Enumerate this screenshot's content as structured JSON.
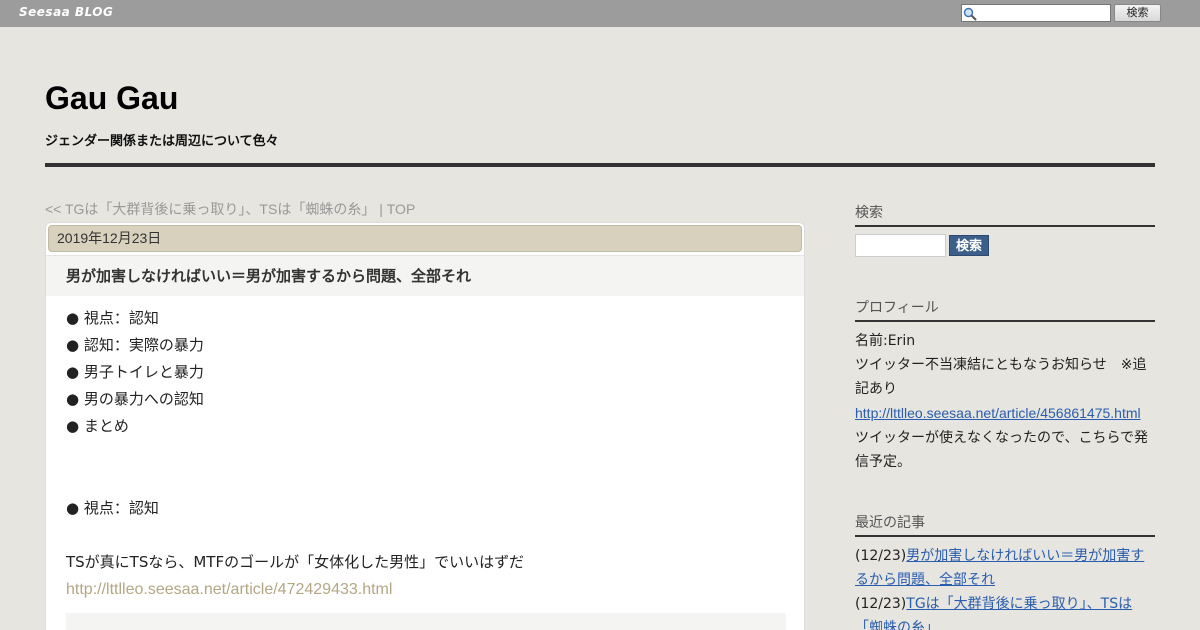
{
  "topbar": {
    "logo": "Seesaa BLOG",
    "search_placeholder": "",
    "search_button": "検索"
  },
  "header": {
    "title": "Gau Gau",
    "description": "ジェンダー関係または周辺について色々"
  },
  "nav": {
    "prev": "<< TGは「大群背後に乗っ取り」、TSは「蜘蛛の糸」",
    "separator": " | ",
    "top": "TOP"
  },
  "article": {
    "date": "2019年12月23日",
    "title": "男が加害しなければいい＝男が加害するから問題、全部それ",
    "toc": [
      "● 視点：認知",
      "● 認知：実際の暴力",
      "● 男子トイレと暴力",
      "● 男の暴力への認知",
      "● まとめ"
    ],
    "section_heading": "● 視点：認知",
    "paragraph": "TSが真にTSなら、MTFのゴールが「女体化した男性」でいいはずだ",
    "paragraph_link": "http://lttlleo.seesaa.net/article/472429433.html"
  },
  "sidebar": {
    "search": {
      "heading": "検索",
      "button": "検索"
    },
    "profile": {
      "heading": "プロフィール",
      "name": "名前:Erin",
      "notice": "ツイッター不当凍結にともなうお知らせ　※追記あり",
      "link": "http://lttlleo.seesaa.net/article/456861475.html",
      "note": "ツイッターが使えなくなったので、こちらで発信予定。"
    },
    "recent": {
      "heading": "最近の記事",
      "items": [
        {
          "date": "(12/23)",
          "title": "男が加害しなければいい＝男が加害するから問題、全部それ"
        },
        {
          "date": "(12/23)",
          "title": "TGは「大群背後に乗っ取り」、TSは「蜘蛛の糸」"
        }
      ]
    }
  }
}
